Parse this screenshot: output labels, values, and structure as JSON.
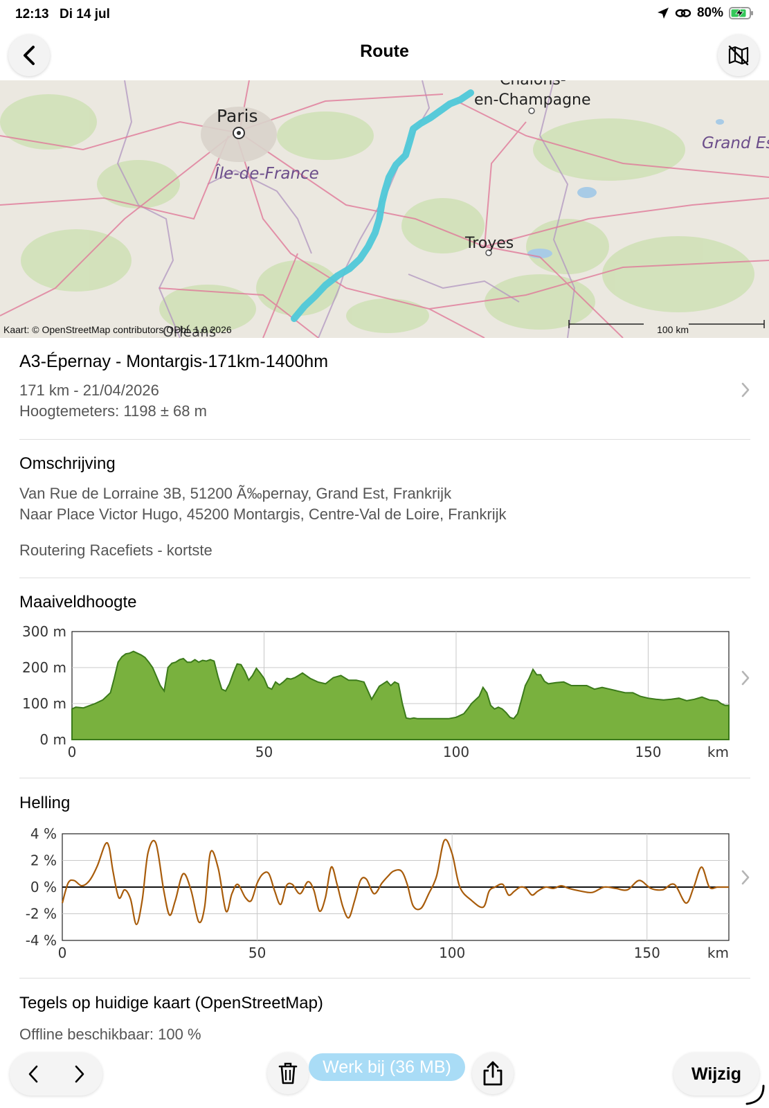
{
  "status_bar": {
    "time": "12:13",
    "date": "Di 14 jul",
    "battery_percent": "80%",
    "icons": [
      "location-arrow-icon",
      "link-icon",
      "battery-charging-icon"
    ]
  },
  "nav": {
    "title": "Route",
    "back_icon": "chevron-left-icon",
    "map_icon": "map-off-icon"
  },
  "map": {
    "labels": {
      "paris": "Paris",
      "idf": "Île-de-France",
      "chalons_top": "Châlons-",
      "chalons": "en-Champagne",
      "troyes": "Troyes",
      "grand_est": "Grand Es",
      "orleans": "Orléans"
    },
    "attribution": "Kaart: © OpenStreetMap contributors ODbL 1.0 2026",
    "scale_label": "100 km",
    "route_color": "#4fc8d8"
  },
  "route_info": {
    "name": "A3-Épernay - Montargis-171km-1400hm",
    "distance_date": "171 km - 21/04/2026",
    "elevation": "Hoogtemeters: 1198 ± 68 m"
  },
  "description": {
    "title": "Omschrijving",
    "from": "Van Rue de Lorraine 3B, 51200 Ã‰pernay, Grand Est, Frankrijk",
    "to": "Naar Place Victor Hugo, 45200 Montargis, Centre-Val de Loire, Frankrijk",
    "routing": "Routering Racefiets - kortste"
  },
  "chart_data": [
    {
      "type": "area",
      "title": "Maaiveldhoogte",
      "x_unit": "km",
      "y_ticks": [
        "300 m",
        "200 m",
        "100 m",
        "0 m"
      ],
      "x_ticks": [
        "0",
        "50",
        "100",
        "150"
      ],
      "xlim": [
        0,
        171
      ],
      "ylim": [
        0,
        300
      ],
      "color": "#79b13e",
      "stroke": "#3b7a1a",
      "x": [
        0,
        1,
        3,
        6,
        8,
        10,
        11,
        12,
        13,
        14,
        15,
        16,
        17,
        18,
        19,
        20,
        21,
        22,
        23,
        24,
        25,
        26,
        27,
        28,
        29,
        30,
        31,
        32,
        33,
        34,
        35,
        36,
        37,
        38,
        39,
        40,
        41,
        42,
        43,
        44,
        45,
        46,
        47,
        48,
        49,
        50,
        51,
        52,
        53,
        54,
        55,
        56,
        57,
        58,
        59,
        60,
        62,
        64,
        66,
        68,
        70,
        72,
        74,
        76,
        78,
        80,
        81,
        82,
        83,
        84,
        85,
        86,
        87,
        88,
        89,
        90,
        92,
        95,
        98,
        100,
        102,
        103,
        104,
        105,
        106,
        107,
        108,
        109,
        110,
        111,
        112,
        113,
        114,
        115,
        116,
        117,
        118,
        119,
        120,
        121,
        122,
        123,
        124,
        126,
        128,
        130,
        132,
        134,
        136,
        138,
        140,
        142,
        144,
        146,
        148,
        150,
        152,
        154,
        156,
        158,
        160,
        162,
        164,
        166,
        168,
        169,
        170,
        171
      ],
      "y": [
        85,
        90,
        88,
        100,
        110,
        130,
        170,
        215,
        230,
        238,
        240,
        245,
        240,
        235,
        228,
        215,
        200,
        175,
        150,
        135,
        200,
        212,
        215,
        222,
        225,
        215,
        215,
        222,
        215,
        220,
        218,
        222,
        218,
        175,
        140,
        135,
        155,
        185,
        210,
        208,
        190,
        165,
        178,
        198,
        185,
        170,
        145,
        140,
        160,
        152,
        160,
        170,
        168,
        172,
        178,
        185,
        170,
        160,
        155,
        172,
        178,
        165,
        165,
        160,
        112,
        148,
        155,
        162,
        150,
        160,
        155,
        100,
        60,
        58,
        60,
        58,
        58,
        58,
        58,
        62,
        72,
        85,
        100,
        110,
        120,
        145,
        130,
        95,
        85,
        90,
        85,
        75,
        62,
        58,
        72,
        110,
        150,
        170,
        195,
        180,
        180,
        162,
        155,
        158,
        160,
        150,
        150,
        150,
        140,
        145,
        140,
        135,
        130,
        130,
        120,
        115,
        112,
        110,
        112,
        115,
        108,
        112,
        118,
        110,
        108,
        100,
        95,
        95
      ]
    },
    {
      "type": "line",
      "title": "Helling",
      "x_unit": "km",
      "y_ticks": [
        "4 %",
        "2 %",
        "0 %",
        "-2 %",
        "-4 %"
      ],
      "x_ticks": [
        "0",
        "50",
        "100",
        "150"
      ],
      "xlim": [
        0,
        171
      ],
      "ylim": [
        -4,
        4
      ],
      "color": "#a85c0b",
      "x": [
        0,
        1.5,
        3,
        5,
        7,
        9,
        11,
        12,
        13,
        14.5,
        16,
        17.5,
        19,
        20.5,
        22,
        24,
        26,
        27.5,
        29,
        31,
        33,
        35,
        36.5,
        38,
        40,
        42,
        43.5,
        45,
        47,
        48.5,
        50,
        51.5,
        53,
        54.5,
        56,
        57.5,
        59,
        61,
        63,
        64.5,
        66,
        67.5,
        69,
        70.5,
        72,
        73.5,
        75,
        76.5,
        78,
        80,
        82,
        83.5,
        85,
        87,
        88.5,
        90,
        92,
        94,
        96,
        98,
        100,
        102,
        105,
        108,
        109.5,
        111,
        113,
        114.5,
        116,
        117.5,
        119,
        120.5,
        122,
        124,
        126,
        128,
        130,
        133,
        136,
        139,
        142,
        145,
        148,
        151,
        154,
        157,
        160,
        162,
        164,
        166,
        168,
        169.5,
        171
      ],
      "y": [
        -1.2,
        0.3,
        0.5,
        0.1,
        0.5,
        1.6,
        3.2,
        3.0,
        1.2,
        -0.8,
        -0.2,
        -0.9,
        -2.8,
        -1.0,
        2.6,
        3.3,
        -0.2,
        -2.1,
        -1.0,
        1.0,
        -0.2,
        -2.6,
        -1.5,
        2.6,
        1.4,
        -1.8,
        -0.5,
        0.2,
        -0.8,
        -1.0,
        0.3,
        1.0,
        1.0,
        -0.3,
        -1.3,
        0.1,
        0.2,
        -0.5,
        0.4,
        -0.2,
        -1.8,
        -0.8,
        1.5,
        0.2,
        -1.5,
        -2.3,
        -1.0,
        0.5,
        0.6,
        -0.5,
        0.3,
        0.8,
        1.2,
        1.2,
        0.2,
        -1.4,
        -1.6,
        -0.5,
        0.8,
        3.5,
        2.5,
        0.0,
        -1.0,
        -1.5,
        -0.3,
        0.0,
        0.2,
        -0.6,
        -0.3,
        0.0,
        -0.1,
        -0.6,
        -0.3,
        0.0,
        -0.1,
        0.1,
        -0.1,
        -0.3,
        -0.4,
        0.0,
        -0.1,
        -0.2,
        0.5,
        -0.1,
        -0.2,
        0.2,
        -1.2,
        0.0,
        1.5,
        0.0,
        0.0,
        0.0,
        0.0
      ]
    }
  ],
  "sections": {
    "elevation_title": "Maaiveldhoogte",
    "slope_title": "Helling",
    "tiles_title": "Tegels op huidige kaart (OpenStreetMap)",
    "offline": "Offline beschikbaar: 100 %"
  },
  "toolbar": {
    "update_label": "Werk bij (36 MB)",
    "edit_label": "Wijzig",
    "accent": "#a9dcf6"
  }
}
